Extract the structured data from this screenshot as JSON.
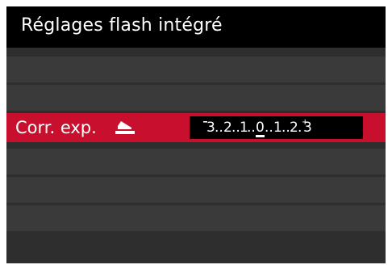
{
  "menu": {
    "title": "Réglages flash intégré",
    "selected_item": {
      "label": "Corr. exp.",
      "icon": "flash-exposure-compensation-icon",
      "value": 0,
      "scale_labels": [
        "3",
        "2",
        "1",
        "0",
        "1",
        "2",
        "3"
      ],
      "scale_min_sign": "-",
      "scale_max_sign": "+"
    },
    "rows": [
      "",
      "",
      "",
      "",
      "",
      ""
    ]
  },
  "colors": {
    "background": "#2e2e2e",
    "title_bar": "#000000",
    "row": "#3a3a3a",
    "selected_row": "#c8102e",
    "scale_background": "#000000",
    "text": "#ffffff"
  }
}
